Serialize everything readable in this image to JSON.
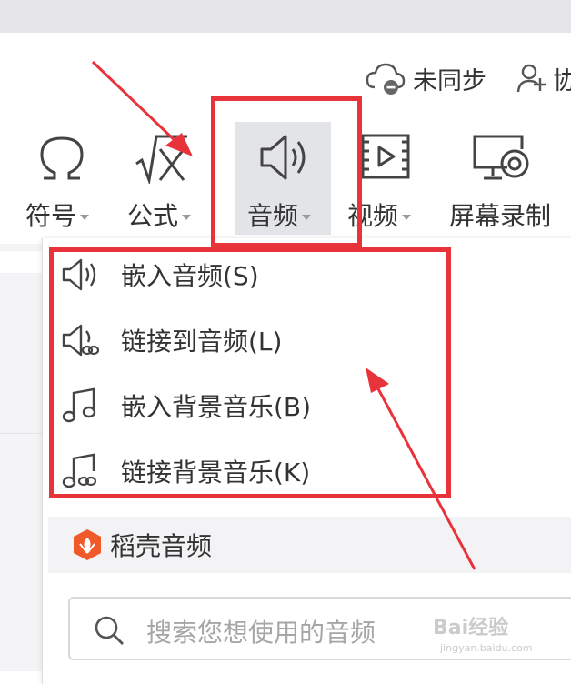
{
  "header": {
    "sync_label": "未同步",
    "share_label": "协"
  },
  "ribbon": {
    "items": [
      {
        "label": "符号",
        "icon": "omega-icon"
      },
      {
        "label": "公式",
        "icon": "formula-icon"
      },
      {
        "label": "音频",
        "icon": "speaker-icon"
      },
      {
        "label": "视频",
        "icon": "video-icon"
      },
      {
        "label": "屏幕录制",
        "icon": "screen-record-icon"
      }
    ]
  },
  "audio_menu": {
    "items": [
      {
        "label": "嵌入音频(S)",
        "icon": "speaker-icon"
      },
      {
        "label": "链接到音频(L)",
        "icon": "speaker-link-icon"
      },
      {
        "label": "嵌入背景音乐(B)",
        "icon": "music-note-icon"
      },
      {
        "label": "链接背景音乐(K)",
        "icon": "music-note-link-icon"
      }
    ],
    "daoke_label": "稻壳音频",
    "search_placeholder": "搜索您想使用的音频"
  },
  "watermark": {
    "text": "Bai经验",
    "sub": "jingyan.baidu.com"
  },
  "colors": {
    "annotation_red": "#e8333a",
    "daoke_orange": "#f05a28",
    "active_bg": "#e3e4e8"
  }
}
